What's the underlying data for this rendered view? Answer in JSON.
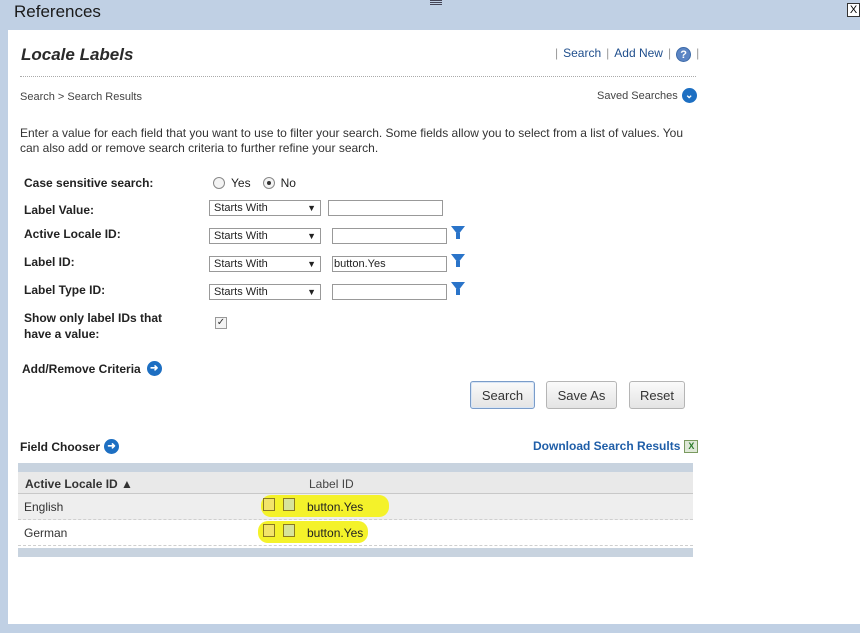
{
  "window": {
    "title": "References",
    "close_glyph": "X"
  },
  "header": {
    "title": "Locale Labels",
    "links": {
      "search": "Search",
      "add_new": "Add New",
      "help_glyph": "?"
    }
  },
  "breadcrumb": "Search > Search Results",
  "saved_searches": {
    "label": "Saved Searches",
    "icon": "chevron-down-circle-icon"
  },
  "intro": "Enter a value for each field that you want to use to filter your search. Some fields allow you to select from a list of values. You can also add or remove search criteria to further refine your search.",
  "form": {
    "case_sensitive": {
      "label": "Case sensitive search:",
      "options": [
        "Yes",
        "No"
      ],
      "selected": "No"
    },
    "label_value": {
      "label": "Label Value:",
      "operator": "Starts With",
      "value": ""
    },
    "active_locale_id": {
      "label": "Active Locale ID:",
      "operator": "Starts With",
      "value": ""
    },
    "label_id": {
      "label": "Label ID:",
      "operator": "Starts With",
      "value": "button.Yes"
    },
    "label_type_id": {
      "label": "Label Type ID:",
      "operator": "Starts With",
      "value": ""
    },
    "show_only": {
      "label_line1": "Show only label IDs that",
      "label_line2": "have a value:",
      "checked": true,
      "glyph": "✓"
    },
    "add_remove": "Add/Remove Criteria"
  },
  "buttons": {
    "search": "Search",
    "save_as": "Save As",
    "reset": "Reset"
  },
  "results": {
    "field_chooser": "Field Chooser",
    "download": "Download Search Results",
    "xls_glyph": "X",
    "columns": {
      "active_locale_id": "Active Locale ID ▲",
      "label_id": "Label ID"
    },
    "rows": [
      {
        "active_locale_id": "English",
        "label_id": "button.Yes"
      },
      {
        "active_locale_id": "German",
        "label_id": "button.Yes"
      }
    ]
  },
  "colors": {
    "accent": "#1f5ea8",
    "highlight": "#f4f22a",
    "chrome": "#c0d0e4"
  }
}
